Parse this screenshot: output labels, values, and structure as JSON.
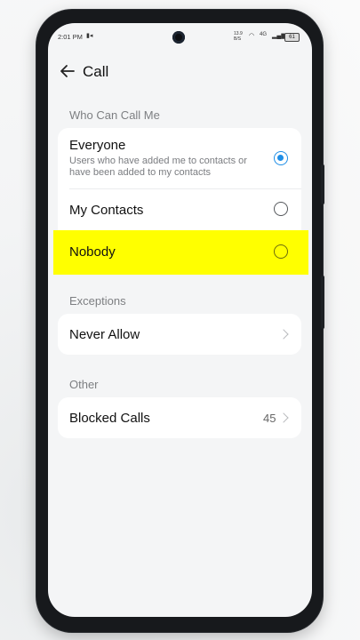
{
  "status_bar": {
    "time": "2:01 PM",
    "net_speed": "13.9 B/S",
    "network": "4G",
    "battery": "61"
  },
  "header": {
    "title": "Call"
  },
  "who_can_call": {
    "section_label": "Who Can Call Me",
    "options": [
      {
        "label": "Everyone",
        "description": "Users who have added me to contacts or have been added to my contacts",
        "selected": true
      },
      {
        "label": "My Contacts",
        "selected": false
      },
      {
        "label": "Nobody",
        "selected": false
      }
    ]
  },
  "exceptions": {
    "section_label": "Exceptions",
    "items": [
      {
        "label": "Never Allow"
      }
    ]
  },
  "other": {
    "section_label": "Other",
    "items": [
      {
        "label": "Blocked Calls",
        "count": "45"
      }
    ]
  },
  "colors": {
    "accent": "#1f8ee6",
    "highlight": "#ffff00",
    "background": "#f4f5f6"
  },
  "icons": {
    "back": "back-arrow-icon",
    "chevron": "chevron-right-icon",
    "camera": "front-camera"
  }
}
